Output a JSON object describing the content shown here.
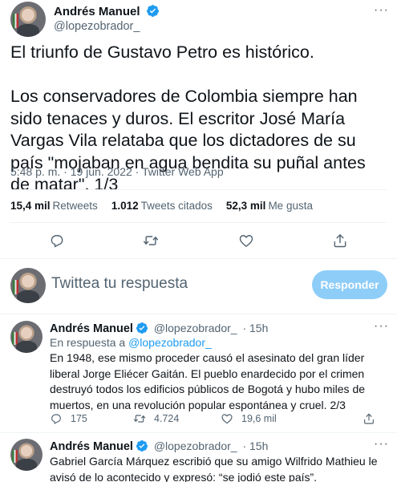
{
  "main_tweet": {
    "author_name": "Andrés Manuel",
    "author_handle": "@lopezobrador_",
    "text": "El triunfo de Gustavo Petro es histórico.\n\nLos conservadores de Colombia siempre han sido tenaces y duros. El escritor José María Vargas Vila relataba que los dictadores de su país \"mojaban en agua bendita su puñal antes de matar\". 1/3",
    "meta": "5:48 p. m. · 19 jun. 2022 · Twitter Web App",
    "stats": {
      "retweets_count": "15,4 mil",
      "retweets_label": "Retweets",
      "quotes_count": "1.012",
      "quotes_label": "Tweets citados",
      "likes_count": "52,3 mil",
      "likes_label": "Me gusta"
    }
  },
  "composer": {
    "placeholder": "Twittea tu respuesta",
    "button_label": "Responder"
  },
  "replies": [
    {
      "author_name": "Andrés Manuel",
      "author_handle": "@lopezobrador_",
      "time": "· 15h",
      "reply_prefix": "En respuesta a",
      "reply_to": "@lopezobrador_",
      "text": "En 1948, ese mismo proceder causó el asesinato del gran líder liberal Jorge Eliécer Gaitán. El pueblo enardecido por el crimen destruyó todos los edificios públicos de Bogotá y hubo miles de muertos, en una revolución popular espontánea y cruel. 2/3",
      "replies_count": "175",
      "retweets_count": "4.724",
      "likes_count": "19,6 mil"
    },
    {
      "author_name": "Andrés Manuel",
      "author_handle": "@lopezobrador_",
      "time": "· 15h",
      "text": "Gabriel García Márquez escribió que su amigo Wilfrido Mathieu le avisó de lo acontecido y expresó: “se jodió este país”."
    }
  ],
  "colors": {
    "accent": "#1d9bf0",
    "reply_button": "#8ecdf8",
    "secondary_text": "#536471",
    "divider": "#eff3f4"
  }
}
